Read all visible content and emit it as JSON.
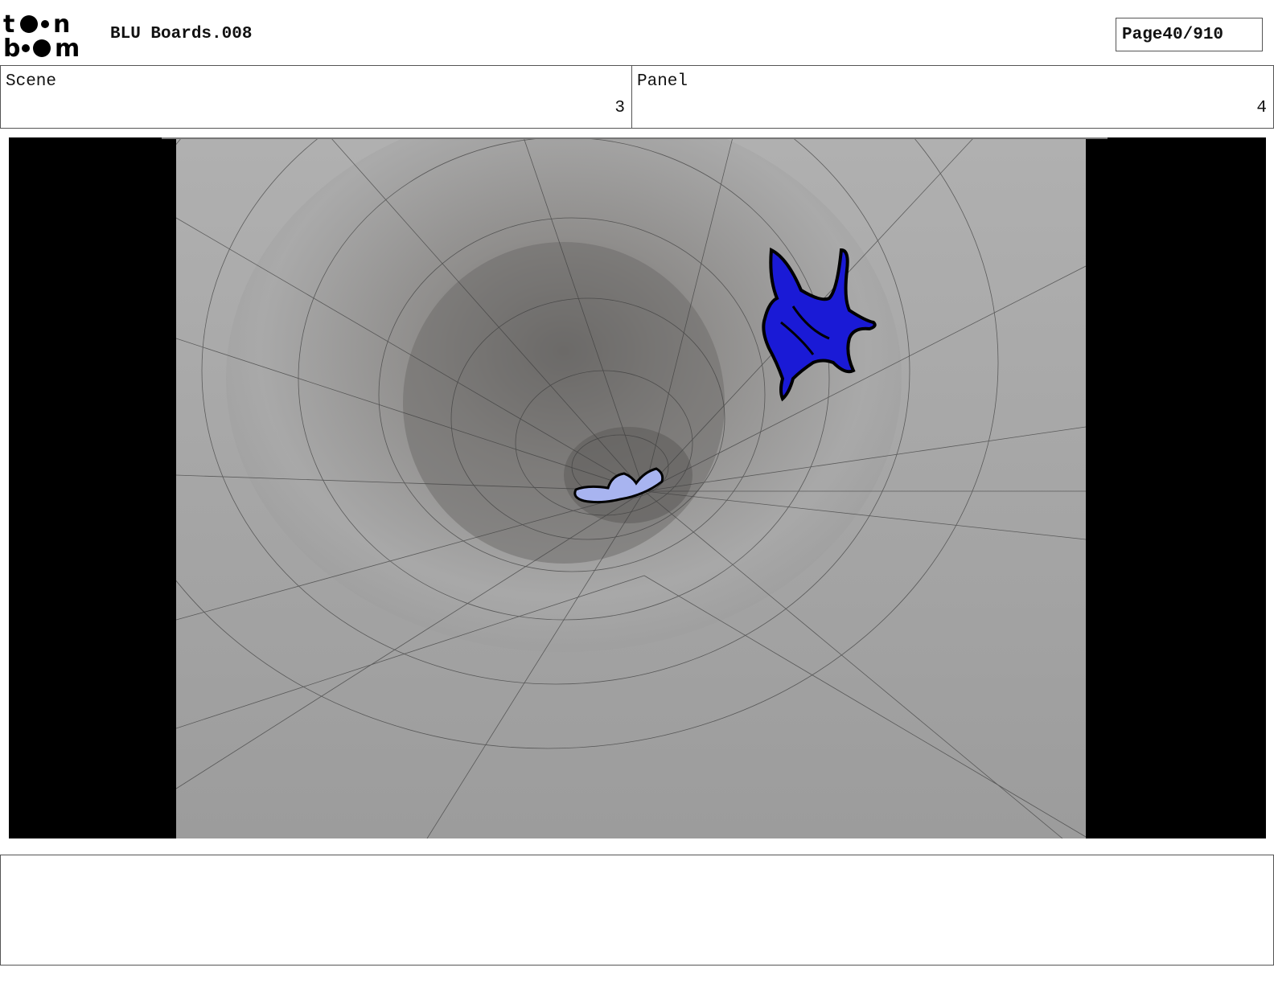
{
  "header": {
    "logo_text": "toon boom",
    "doc_title": "BLU Boards.008",
    "page_label": "Page",
    "page_value": "40/910"
  },
  "meta": {
    "scene_label": "Scene",
    "scene_value": "3",
    "panel_label": "Panel",
    "panel_value": "4"
  },
  "frame": {
    "description_icon": "storyboard-panel-image",
    "character_colors": {
      "dark_blue": "#1a1ad6",
      "light_blue": "#a8b4f0"
    }
  },
  "notes": {
    "text": ""
  }
}
